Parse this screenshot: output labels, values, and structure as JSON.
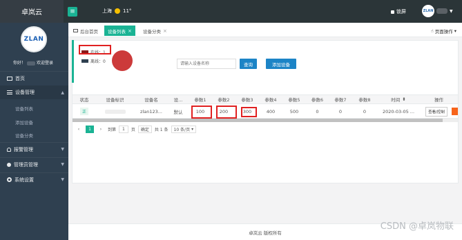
{
  "app": {
    "brand": "卓岚云"
  },
  "header": {
    "weather_city": "上海",
    "weather_temp": "11°",
    "lock_label": "锁屏",
    "avatar_logo": "ZLAN"
  },
  "sidebar": {
    "logo": "ZLAN",
    "welcome_prefix": "你好！",
    "welcome_suffix": "欢迎登录",
    "items": [
      {
        "label": "首页"
      },
      {
        "label": "设备管理"
      },
      {
        "label": "设备列表"
      },
      {
        "label": "添加设备"
      },
      {
        "label": "设备分类"
      },
      {
        "label": "报警管理"
      },
      {
        "label": "管理员管理"
      },
      {
        "label": "系统设置"
      }
    ]
  },
  "tabs": {
    "home": "后台首页",
    "device_list": "设备列表",
    "device_category": "设备分类",
    "page_ops": "页面操作"
  },
  "filter": {
    "online_label": "在线：1",
    "offline_label": "离线：0",
    "search_placeholder": "请输入设备名称",
    "query_button": "查询",
    "add_button": "添加设备",
    "online_color": "#8b1a1a",
    "offline_color": "#2f4050"
  },
  "table": {
    "headers": [
      "状态",
      "设备标识",
      "设备名",
      "设...",
      "参数1",
      "参数2",
      "参数3",
      "参数4",
      "参数5",
      "参数6",
      "参数7",
      "参数8",
      "时间",
      "操作"
    ],
    "row": {
      "status": "正",
      "name": "zlan123...",
      "group": "默认",
      "p1": "100",
      "p2": "200",
      "p3": "300",
      "p4": "400",
      "p5": "500",
      "p6": "0",
      "p7": "0",
      "p8": "0",
      "time": "2020-03-05 ...",
      "op": "查看/控制"
    }
  },
  "pager": {
    "prev": "‹",
    "current": "1",
    "next": "›",
    "goto": "到第",
    "page_input": "1",
    "page_unit": "页",
    "confirm": "确定",
    "total": "共 1 条",
    "per_page": "10 条/页"
  },
  "footer": {
    "text": "卓岚云 版权所有"
  },
  "watermark": {
    "text": "CSDN @卓岚物联"
  }
}
